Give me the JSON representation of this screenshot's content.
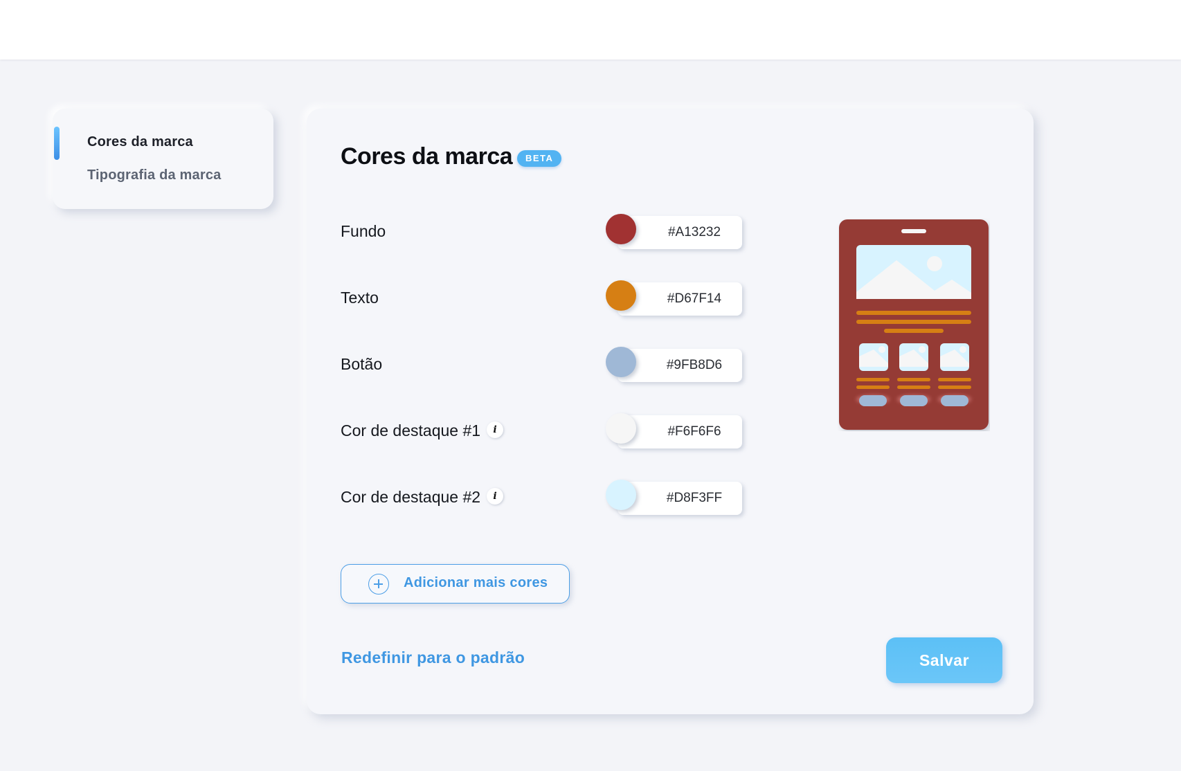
{
  "sidebar": {
    "items": [
      {
        "label": "Cores da marca",
        "active": true
      },
      {
        "label": "Tipografia da marca",
        "active": false
      }
    ]
  },
  "main": {
    "title": "Cores da marca",
    "badge": "BETA",
    "colors": [
      {
        "label": "Fundo",
        "hex": "#A13232",
        "has_info": false
      },
      {
        "label": "Texto",
        "hex": "#D67F14",
        "has_info": false
      },
      {
        "label": "Botão",
        "hex": "#9FB8D6",
        "has_info": false
      },
      {
        "label": "Cor de destaque #1",
        "hex": "#F6F6F6",
        "has_info": true
      },
      {
        "label": "Cor de destaque #2",
        "hex": "#D8F3FF",
        "has_info": true
      }
    ],
    "add_button_label": "Adicionar mais cores",
    "reset_label": "Redefinir para o padrão",
    "save_label": "Salvar"
  },
  "theme": {
    "accent": "#3F97E2",
    "badge_color": "#52B3F2",
    "preview_background": "#953A36",
    "preview_text": "#D67F14",
    "preview_button": "#9FB8D6",
    "preview_accent1": "#F6F6F6",
    "preview_accent2": "#D8F3FF"
  }
}
